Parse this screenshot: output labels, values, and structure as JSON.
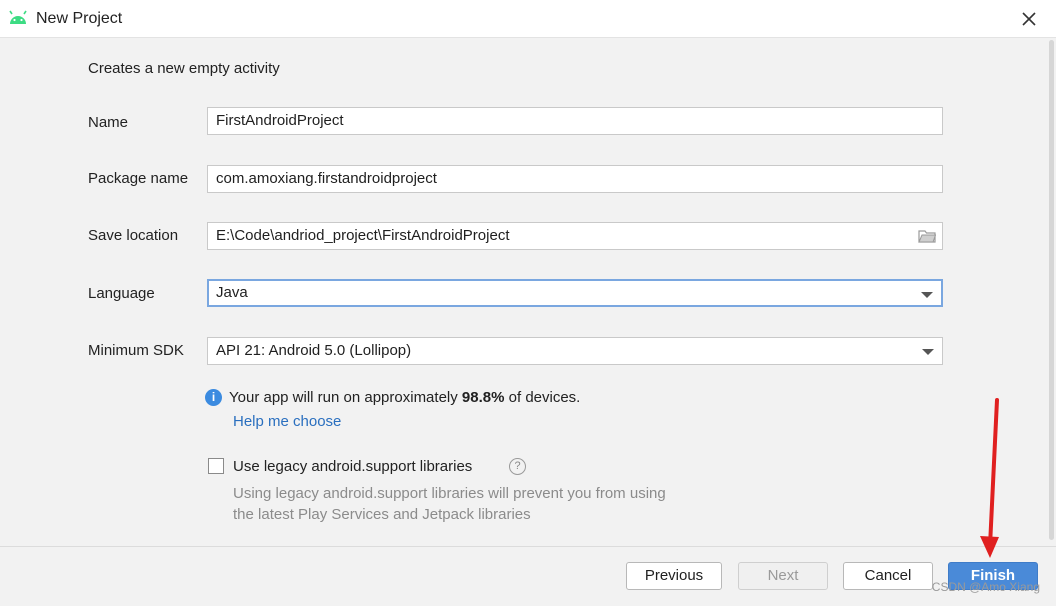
{
  "window": {
    "title": "New Project"
  },
  "form": {
    "subtitle": "Creates a new empty activity",
    "name": {
      "label": "Name",
      "value": "FirstAndroidProject"
    },
    "package": {
      "label": "Package name",
      "value": "com.amoxiang.firstandroidproject"
    },
    "save_location": {
      "label": "Save location",
      "value": "E:\\Code\\andriod_project\\FirstAndroidProject"
    },
    "language": {
      "label": "Language",
      "value": "Java"
    },
    "min_sdk": {
      "label": "Minimum SDK",
      "value": "API 21: Android 5.0 (Lollipop)"
    },
    "info": {
      "prefix": "Your app will run on approximately ",
      "percent": "98.8%",
      "suffix": " of devices.",
      "help_link": "Help me choose"
    },
    "legacy": {
      "label": "Use legacy android.support libraries",
      "checked": false,
      "hint_line1": "Using legacy android.support libraries will prevent you from using",
      "hint_line2": "the latest Play Services and Jetpack libraries"
    }
  },
  "buttons": {
    "previous": "Previous",
    "next": "Next",
    "cancel": "Cancel",
    "finish": "Finish"
  },
  "watermark": "CSDN @Amo Xiang",
  "colors": {
    "android_green": "#3ddc84",
    "primary_button": "#4a8ad8",
    "link": "#2a6fbf",
    "annotation_arrow": "#e02020"
  },
  "icons": {
    "title": "android-icon",
    "close": "close-icon",
    "folder": "folder-icon",
    "dropdown": "chevron-down-icon",
    "info": "info-icon",
    "help": "help-icon"
  }
}
